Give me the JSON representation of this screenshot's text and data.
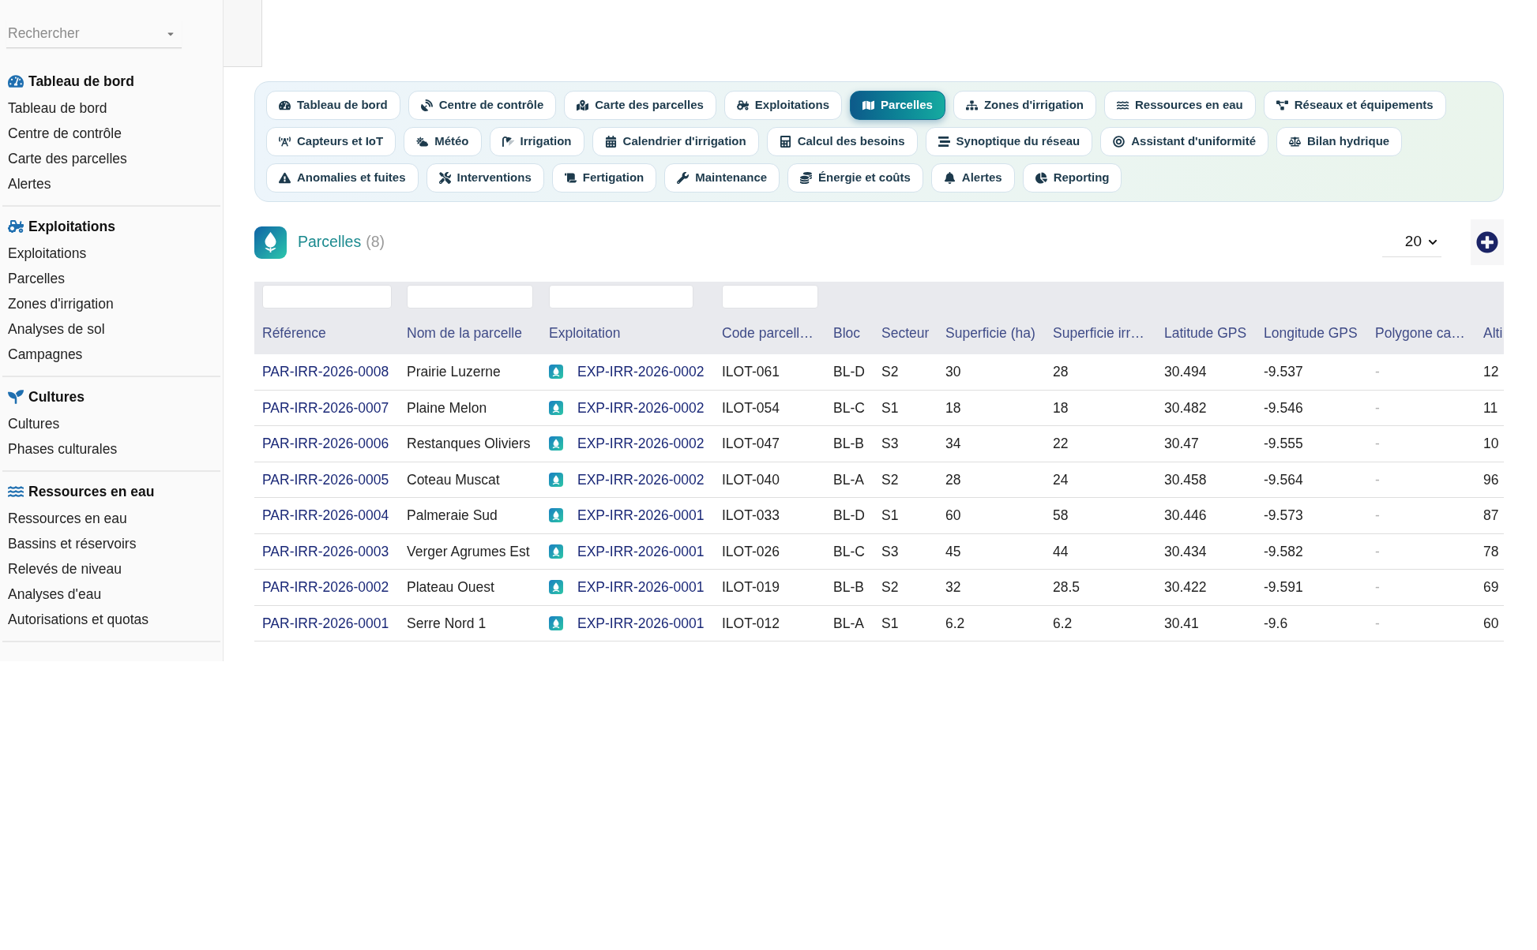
{
  "sidebar": {
    "search": {
      "placeholder": "Rechercher"
    },
    "sections": [
      {
        "title": "Tableau de bord",
        "items": [
          "Tableau de bord",
          "Centre de contrôle",
          "Carte des parcelles",
          "Alertes"
        ]
      },
      {
        "title": "Exploitations",
        "items": [
          "Exploitations",
          "Parcelles",
          "Zones d'irrigation",
          "Analyses de sol",
          "Campagnes"
        ]
      },
      {
        "title": "Cultures",
        "items": [
          "Cultures",
          "Phases culturales"
        ]
      },
      {
        "title": "Ressources en eau",
        "items": [
          "Ressources en eau",
          "Bassins et réservoirs",
          "Relevés de niveau",
          "Analyses d'eau",
          "Autorisations et quotas"
        ]
      }
    ]
  },
  "tab_rows": [
    {
      "tabs": [
        {
          "label": "Tableau de bord",
          "selected": false
        },
        {
          "label": "Centre de contrôle",
          "selected": false
        },
        {
          "label": "Carte des parcelles",
          "selected": false
        },
        {
          "label": "Exploitations",
          "selected": false
        },
        {
          "label": "Parcelles",
          "selected": true
        },
        {
          "label": "Zones d'irrigation",
          "selected": false
        },
        {
          "label": "Ressources en eau",
          "selected": false
        },
        {
          "label": "Réseaux et équipements",
          "selected": false
        }
      ]
    },
    {
      "tabs": [
        {
          "label": "Capteurs et IoT",
          "selected": false
        },
        {
          "label": "Météo",
          "selected": false
        },
        {
          "label": "Irrigation",
          "selected": false
        },
        {
          "label": "Calendrier d'irrigation",
          "selected": false
        },
        {
          "label": "Calcul des besoins",
          "selected": false
        },
        {
          "label": "Synoptique du réseau",
          "selected": false
        },
        {
          "label": "Assistant d'uniformité",
          "selected": false
        },
        {
          "label": "Bilan hydrique",
          "selected": false
        }
      ]
    },
    {
      "tabs": [
        {
          "label": "Anomalies et fuites",
          "selected": false
        },
        {
          "label": "Interventions",
          "selected": false
        },
        {
          "label": "Fertigation",
          "selected": false
        },
        {
          "label": "Maintenance",
          "selected": false
        },
        {
          "label": "Énergie et coûts",
          "selected": false
        },
        {
          "label": "Alertes",
          "selected": false
        },
        {
          "label": "Reporting",
          "selected": false
        }
      ]
    }
  ],
  "page_header": {
    "title": "Parcelles",
    "count": "(8)",
    "page_size": "20"
  },
  "table": {
    "columns": [
      {
        "label": "Référence",
        "kind": "link",
        "filter": true
      },
      {
        "label": "Nom de la parcelle",
        "kind": "text",
        "filter": true
      },
      {
        "label": "Exploitation",
        "kind": "record_link",
        "filter": true
      },
      {
        "label": "Code parcell…",
        "kind": "text",
        "filter": true
      },
      {
        "label": "Bloc",
        "kind": "text",
        "filter": false
      },
      {
        "label": "Secteur",
        "kind": "text",
        "filter": false
      },
      {
        "label": "Superficie (ha)",
        "kind": "text",
        "filter": false
      },
      {
        "label": "Superficie irr…",
        "kind": "text",
        "filter": false
      },
      {
        "label": "Latitude GPS",
        "kind": "text",
        "filter": false
      },
      {
        "label": "Longitude GPS",
        "kind": "text",
        "filter": false
      },
      {
        "label": "Polygone ca…",
        "kind": "placeholder",
        "filter": false
      },
      {
        "label": "Alti",
        "kind": "text",
        "filter": false
      }
    ],
    "rows": [
      [
        "PAR-IRR-2026-0008",
        "Prairie Luzerne",
        "EXP-IRR-2026-0002",
        "ILOT-061",
        "BL-D",
        "S2",
        "30",
        "28",
        "30.494",
        "-9.537",
        "-",
        "12"
      ],
      [
        "PAR-IRR-2026-0007",
        "Plaine Melon",
        "EXP-IRR-2026-0002",
        "ILOT-054",
        "BL-C",
        "S1",
        "18",
        "18",
        "30.482",
        "-9.546",
        "-",
        "11"
      ],
      [
        "PAR-IRR-2026-0006",
        "Restanques Oliviers",
        "EXP-IRR-2026-0002",
        "ILOT-047",
        "BL-B",
        "S3",
        "34",
        "22",
        "30.47",
        "-9.555",
        "-",
        "10"
      ],
      [
        "PAR-IRR-2026-0005",
        "Coteau Muscat",
        "EXP-IRR-2026-0002",
        "ILOT-040",
        "BL-A",
        "S2",
        "28",
        "24",
        "30.458",
        "-9.564",
        "-",
        "96"
      ],
      [
        "PAR-IRR-2026-0004",
        "Palmeraie Sud",
        "EXP-IRR-2026-0001",
        "ILOT-033",
        "BL-D",
        "S1",
        "60",
        "58",
        "30.446",
        "-9.573",
        "-",
        "87"
      ],
      [
        "PAR-IRR-2026-0003",
        "Verger Agrumes Est",
        "EXP-IRR-2026-0001",
        "ILOT-026",
        "BL-C",
        "S3",
        "45",
        "44",
        "30.434",
        "-9.582",
        "-",
        "78"
      ],
      [
        "PAR-IRR-2026-0002",
        "Plateau Ouest",
        "EXP-IRR-2026-0001",
        "ILOT-019",
        "BL-B",
        "S2",
        "32",
        "28.5",
        "30.422",
        "-9.591",
        "-",
        "69"
      ],
      [
        "PAR-IRR-2026-0001",
        "Serre Nord 1",
        "EXP-IRR-2026-0001",
        "ILOT-012",
        "BL-A",
        "S1",
        "6.2",
        "6.2",
        "30.41",
        "-9.6",
        "-",
        "60"
      ]
    ]
  }
}
